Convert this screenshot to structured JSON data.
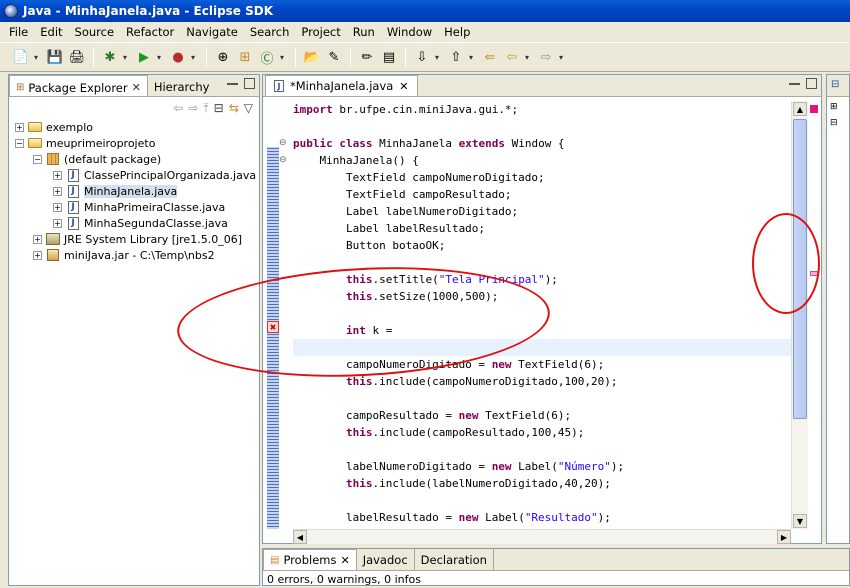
{
  "window": {
    "title": "Java - MinhaJanela.java - Eclipse SDK"
  },
  "menu": [
    "File",
    "Edit",
    "Source",
    "Refactor",
    "Navigate",
    "Search",
    "Project",
    "Run",
    "Window",
    "Help"
  ],
  "left_view": {
    "tabs": [
      {
        "label": "Package Explorer",
        "active": true
      },
      {
        "label": "Hierarchy",
        "active": false
      }
    ],
    "tree": [
      {
        "label": "exemplo",
        "level": 0,
        "expander": "+",
        "icon": "project-folder-icon"
      },
      {
        "label": "meuprimeiroprojeto",
        "level": 0,
        "expander": "−",
        "icon": "project-folder-icon"
      },
      {
        "label": "(default package)",
        "level": 1,
        "expander": "−",
        "icon": "package-icon"
      },
      {
        "label": "ClassePrincipalOrganizada.java",
        "level": 2,
        "expander": "+",
        "icon": "java-file-icon"
      },
      {
        "label": "MinhaJanela.java",
        "level": 2,
        "expander": "+",
        "icon": "java-file-icon",
        "selected": true
      },
      {
        "label": "MinhaPrimeiraClasse.java",
        "level": 2,
        "expander": "+",
        "icon": "java-file-icon"
      },
      {
        "label": "MinhaSegundaClasse.java",
        "level": 2,
        "expander": "+",
        "icon": "java-file-icon"
      },
      {
        "label": "JRE System Library [jre1.5.0_06]",
        "level": 1,
        "expander": "+",
        "icon": "library-icon"
      },
      {
        "label": "miniJava.jar - C:\\Temp\\nbs2",
        "level": 1,
        "expander": "+",
        "icon": "jar-icon"
      }
    ]
  },
  "editor": {
    "tab_label": "*MinhaJanela.java",
    "lines": [
      [
        {
          "t": "import",
          "c": "kw"
        },
        {
          "t": " br.ufpe.cin.miniJava.gui.*;"
        }
      ],
      [
        {
          "t": ""
        }
      ],
      [
        {
          "t": "public",
          "c": "kw"
        },
        {
          "t": " "
        },
        {
          "t": "class",
          "c": "kw"
        },
        {
          "t": " MinhaJanela "
        },
        {
          "t": "extends",
          "c": "kw"
        },
        {
          "t": " Window {"
        }
      ],
      [
        {
          "t": "    MinhaJanela() {"
        }
      ],
      [
        {
          "t": "        TextField campoNumeroDigitado;"
        }
      ],
      [
        {
          "t": "        TextField campoResultado;"
        }
      ],
      [
        {
          "t": "        Label labelNumeroDigitado;"
        }
      ],
      [
        {
          "t": "        Label labelResultado;"
        }
      ],
      [
        {
          "t": "        Button botaoOK;"
        }
      ],
      [
        {
          "t": ""
        }
      ],
      [
        {
          "t": "        "
        },
        {
          "t": "this",
          "c": "kw"
        },
        {
          "t": ".setTitle("
        },
        {
          "t": "\"Tela Principal\"",
          "c": "str"
        },
        {
          "t": ");"
        }
      ],
      [
        {
          "t": "        "
        },
        {
          "t": "this",
          "c": "kw"
        },
        {
          "t": ".setSize(1000,500);"
        }
      ],
      [
        {
          "t": ""
        }
      ],
      [
        {
          "t": "        "
        },
        {
          "t": "int",
          "c": "kw"
        },
        {
          "t": " k ="
        }
      ],
      [
        {
          "t": ""
        }
      ],
      [
        {
          "t": "        campoNumeroDigitado = "
        },
        {
          "t": "new",
          "c": "kw"
        },
        {
          "t": " TextField(6);"
        }
      ],
      [
        {
          "t": "        "
        },
        {
          "t": "this",
          "c": "kw"
        },
        {
          "t": ".include(campoNumeroDigitado,100,20);"
        }
      ],
      [
        {
          "t": ""
        }
      ],
      [
        {
          "t": "        campoResultado = "
        },
        {
          "t": "new",
          "c": "kw"
        },
        {
          "t": " TextField(6);"
        }
      ],
      [
        {
          "t": "        "
        },
        {
          "t": "this",
          "c": "kw"
        },
        {
          "t": ".include(campoResultado,100,45);"
        }
      ],
      [
        {
          "t": ""
        }
      ],
      [
        {
          "t": "        labelNumeroDigitado = "
        },
        {
          "t": "new",
          "c": "kw"
        },
        {
          "t": " Label("
        },
        {
          "t": "\"Número\"",
          "c": "str"
        },
        {
          "t": ");"
        }
      ],
      [
        {
          "t": "        "
        },
        {
          "t": "this",
          "c": "kw"
        },
        {
          "t": ".include(labelNumeroDigitado,40,20);"
        }
      ],
      [
        {
          "t": ""
        }
      ],
      [
        {
          "t": "        labelResultado = "
        },
        {
          "t": "new",
          "c": "kw"
        },
        {
          "t": " Label("
        },
        {
          "t": "\"Resultado\"",
          "c": "str"
        },
        {
          "t": ");"
        }
      ]
    ],
    "current_line": 14
  },
  "bottom": {
    "tabs": [
      {
        "label": "Problems",
        "active": true
      },
      {
        "label": "Javadoc",
        "active": false
      },
      {
        "label": "Declaration",
        "active": false
      }
    ],
    "status": "0 errors, 0 warnings, 0 infos"
  },
  "colors": {
    "keyword": "#7f0055",
    "string": "#2a00ff",
    "annotation": "#e01010"
  }
}
